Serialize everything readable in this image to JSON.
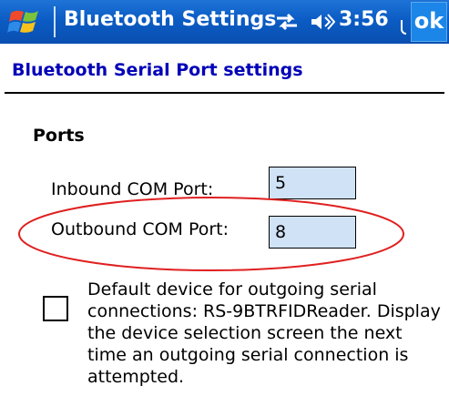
{
  "titlebar": {
    "title": "Bluetooth Settings",
    "clock": "3:56",
    "ok_label": "ok",
    "start_icon": "windows-flag-icon",
    "connectivity_icon": "connectivity-icon",
    "volume_icon": "speaker-icon"
  },
  "header": {
    "title": "Bluetooth Serial Port settings"
  },
  "ports": {
    "section_title": "Ports",
    "inbound_label": "Inbound COM Port:",
    "inbound_value": "5",
    "outbound_label": "Outbound COM Port:",
    "outbound_value": "8"
  },
  "default_device": {
    "checked": false,
    "text": "Default device for outgoing serial connections: RS-9BTRFIDReader. Display the device selection screen the next time an outgoing serial connection is attempted."
  },
  "colors": {
    "titlebar": "#0b5cc4",
    "header_text": "#0000b8",
    "input_bg": "#d0e2f6",
    "annotation_ellipse": "#e02020"
  }
}
